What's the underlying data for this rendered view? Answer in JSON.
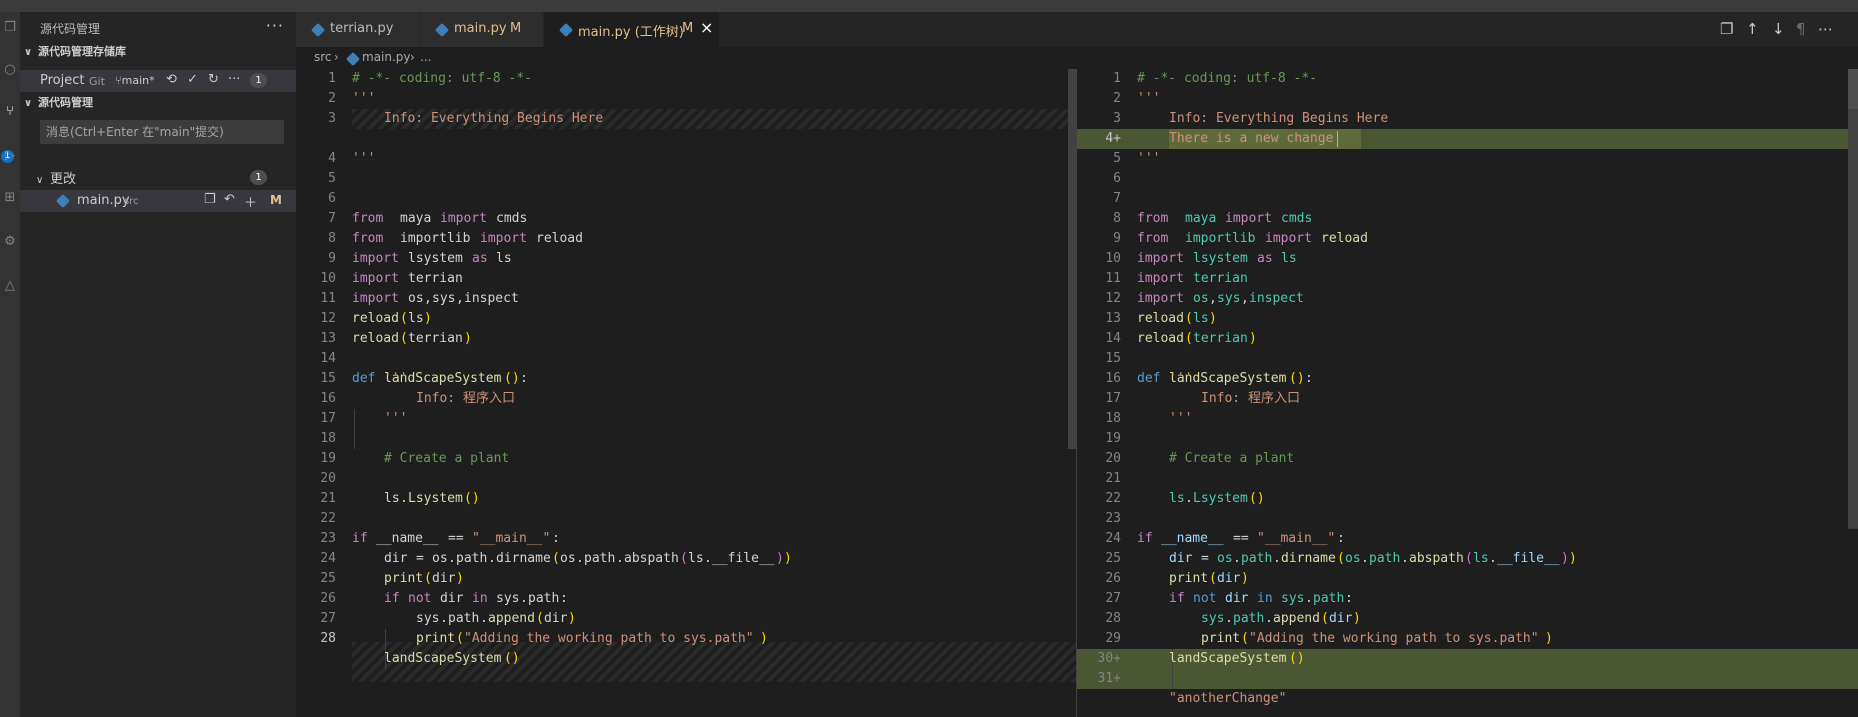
{
  "sidebar": {
    "title": "源代码管理",
    "more": "···",
    "repos_section": "源代码管理存储库",
    "repo": {
      "name": "Project",
      "vcs": "Git",
      "branch": "main*",
      "count": "1"
    },
    "scm_section": "源代码管理",
    "commit_placeholder": "消息(Ctrl+Enter 在\"main\"提交)",
    "changes": {
      "label": "更改",
      "count": "1"
    },
    "file": {
      "name": "main.py",
      "dir": "src",
      "status": "M"
    },
    "activity_badge": "1"
  },
  "tabs": [
    {
      "label": "terrian.py",
      "modified": ""
    },
    {
      "label": "main.py",
      "modified": "M"
    },
    {
      "label": "main.py (工作树)",
      "modified": "M"
    }
  ],
  "breadcrumb": {
    "folder": "src",
    "file": "main.py",
    "ellipsis": "..."
  },
  "left_lines": [
    "1",
    "2",
    "3",
    "4",
    "5",
    "6",
    "7",
    "8",
    "9",
    "10",
    "11",
    "12",
    "13",
    "14",
    "15",
    "16",
    "17",
    "18",
    "19",
    "20",
    "21",
    "22",
    "23",
    "24",
    "25",
    "26",
    "27",
    "28"
  ],
  "right_lines": [
    "1",
    "2",
    "3",
    "4+",
    "5",
    "6",
    "7",
    "8",
    "9",
    "10",
    "11",
    "12",
    "13",
    "14",
    "15",
    "16",
    "17",
    "18",
    "19",
    "20",
    "21",
    "22",
    "23",
    "24",
    "25",
    "26",
    "27",
    "28",
    "29",
    "30+",
    "31+"
  ],
  "code": {
    "coding": "# -*- coding: utf-8 -*-",
    "triple": "'''",
    "info1": "Info: Everything Begins Here",
    "newchange": "There is a new change",
    "from": "from",
    "import": "import",
    "as": "as",
    "maya": "maya",
    "cmds": "cmds",
    "importlib": "importlib",
    "reload": "reload",
    "lsystem": "lsystem",
    "ls": "ls",
    "terrian": "terrian",
    "os": "os",
    "sys": "sys",
    "inspect": "inspect",
    "comma": ",",
    "def": "def",
    "landScapeSystem": "landScapeSystem",
    "info2": "Info: 程序入口",
    "comment": "# Create a plant",
    "Lsystem": "Lsystem",
    "if": "if",
    "not": "not",
    "in": "in",
    "name": "__name__",
    "eq": "==",
    "main": "\"__main__\"",
    "colon": ":",
    "dir": "dir",
    "path": "path",
    "dirname": "dirname",
    "abspath": "abspath",
    "file": "__file__",
    "print": "print",
    "append": "append",
    "adding": "\"Adding the working path to sys.path\"",
    "another": "\"anotherChange\"",
    "dot": ".",
    "assign": "="
  },
  "colors": {
    "added": "#4b5632",
    "accent": "#0e70c0",
    "modified": "#e2c08d"
  }
}
